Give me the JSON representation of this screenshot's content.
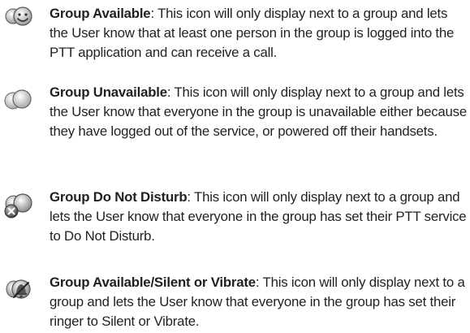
{
  "entries": [
    {
      "icon": "group-available-icon",
      "term": "Group Available",
      "description": ": This icon will only display next to a group and lets the User know that at least one person in the group is logged into the PTT application and can receive a call."
    },
    {
      "icon": "group-unavailable-icon",
      "term": "Group Unavailable",
      "description": ": This icon will only display next to a group and lets the User know that everyone in the group is unavailable either because they have logged out of the service, or powered off their handsets."
    },
    {
      "icon": "group-do-not-disturb-icon",
      "term": "Group Do Not Disturb",
      "description": ": This icon will only display next to a group and lets the User know that everyone in the group has set their PTT service to Do Not Disturb."
    },
    {
      "icon": "group-silent-vibrate-icon",
      "term": "Group Available/Silent or Vibrate",
      "description": ": This icon will only display next to a group and lets the User know that everyone in the group has set their ringer to Silent or Vibrate."
    }
  ]
}
